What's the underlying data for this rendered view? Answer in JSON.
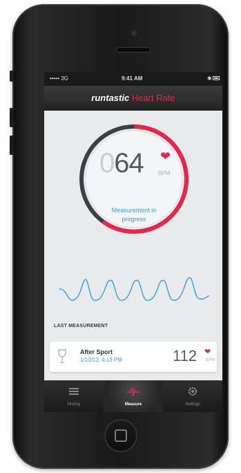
{
  "status_bar": {
    "carrier": "••••• 3G",
    "time": "9:41 AM",
    "bluetooth": "✱"
  },
  "header": {
    "brand": "runtastic",
    "title": "Heart Rate"
  },
  "measurement": {
    "lead_digit": "0",
    "value": "64",
    "unit": "BPM",
    "status_line1": "Measurement in",
    "status_line2": "progress",
    "progress_fraction": 0.6
  },
  "last_measurement": {
    "section_label": "LAST MEASUREMENT",
    "title": "After Sport",
    "date": "1/10/13, 4:13 PM",
    "value": "112",
    "unit": "BPM"
  },
  "tabs": [
    {
      "label": "History",
      "icon": "list-icon",
      "active": false
    },
    {
      "label": "Measure",
      "icon": "heartbeat-icon",
      "active": true
    },
    {
      "label": "Settings",
      "icon": "gear-icon",
      "active": false
    }
  ],
  "colors": {
    "accent": "#e6264a",
    "link": "#3d9ad6",
    "wave": "#4aa6e0"
  }
}
